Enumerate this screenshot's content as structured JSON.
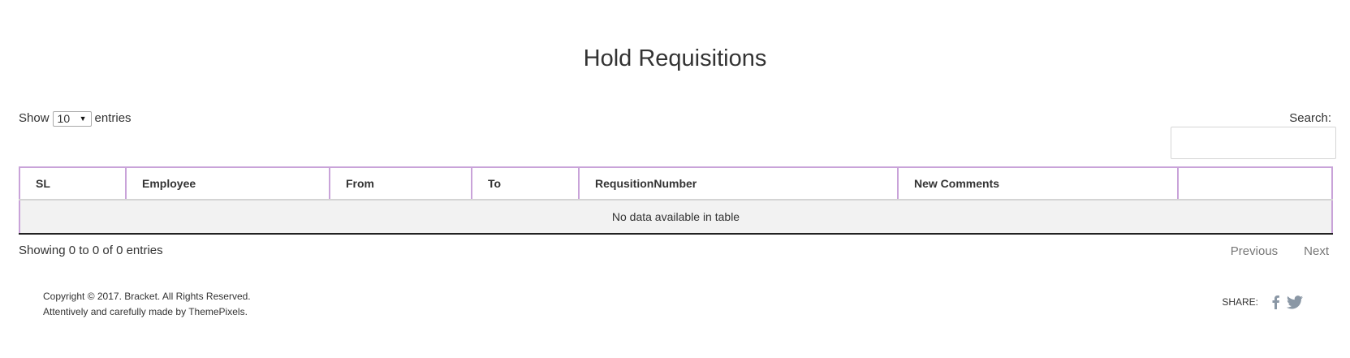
{
  "page": {
    "title": "Hold Requisitions"
  },
  "controls": {
    "show_label": "Show",
    "length_value": "10",
    "entries_label": "entries",
    "search_label": "Search:",
    "search_value": "",
    "search_placeholder": ""
  },
  "table": {
    "columns": [
      "SL",
      "Employee",
      "From",
      "To",
      "RequsitionNumber",
      "New Comments",
      ""
    ],
    "empty_message": "No data available in table"
  },
  "table_info": {
    "text": "Showing 0 to 0 of 0 entries"
  },
  "pagination": {
    "previous_label": "Previous",
    "next_label": "Next"
  },
  "footer": {
    "copyright": "Copyright © 2017. Bracket. All Rights Reserved.",
    "credit": "Attentively and carefully made by ThemePixels.",
    "share_label": "SHARE:",
    "social_icons": [
      "facebook-icon",
      "twitter-icon"
    ],
    "icon_color": "#8a97a5"
  }
}
